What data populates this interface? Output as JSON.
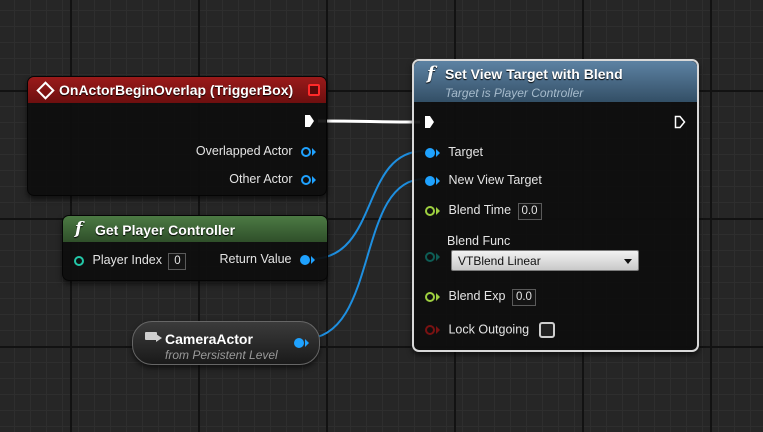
{
  "event_node": {
    "title": "OnActorBeginOverlap (TriggerBox)",
    "outputs": [
      "Overlapped Actor",
      "Other Actor"
    ]
  },
  "get_pc_node": {
    "title": "Get Player Controller",
    "player_index_label": "Player Index",
    "player_index_value": "0",
    "return_label": "Return Value"
  },
  "camera_node": {
    "title": "CameraActor",
    "subtitle": "from Persistent Level"
  },
  "set_view_node": {
    "title": "Set View Target with Blend",
    "subtitle": "Target is Player Controller",
    "target_label": "Target",
    "new_view_target_label": "New View Target",
    "blend_time_label": "Blend Time",
    "blend_time_value": "0.0",
    "blend_func_label": "Blend Func",
    "blend_func_value": "VTBlend Linear",
    "blend_exp_label": "Blend Exp",
    "blend_exp_value": "0.0",
    "lock_outgoing_label": "Lock Outgoing"
  },
  "colors": {
    "event_header": "#8a1414",
    "function_header": "#3f6a38",
    "set_view_header": "#4a6e8d",
    "object_pin": "#1fa2ff",
    "float_pin": "#9ed040",
    "enum_pin": "#0e5d55",
    "bool_pin": "#7a1212"
  }
}
